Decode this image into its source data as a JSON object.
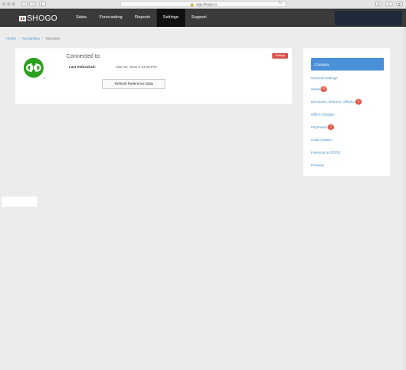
{
  "browser": {
    "url": "app.shogo.io",
    "lock_icon": "lock-icon",
    "back_glyph": "‹",
    "forward_glyph": "›",
    "reload_glyph": "↻",
    "share_glyph": "⇪",
    "tabs_glyph": "⧉"
  },
  "topnav": {
    "brand": "SHOGO",
    "items": [
      {
        "label": "Sales"
      },
      {
        "label": "Forecasting"
      },
      {
        "label": "Reports"
      },
      {
        "label": "Settings",
        "active": true
      },
      {
        "label": "Support"
      }
    ]
  },
  "breadcrumb": {
    "home": "Home",
    "accounting": "Accounting",
    "current": "Sessions",
    "separator": "/"
  },
  "connection": {
    "title": "Connected to:",
    "last_refreshed_label": "Last Refreshed:",
    "last_refreshed_value": "Mar 30, 2016 2:24:28 PM",
    "refresh_button": "Refresh Reference Data",
    "change_button": "Change",
    "logo_text": "qb",
    "logo_reg": "®"
  },
  "settings_menu": {
    "items": [
      {
        "label": "Company",
        "active": true
      },
      {
        "label": "General Settings"
      },
      {
        "label": "Sales",
        "badge": "10"
      },
      {
        "label": "Discounts, Returns, Offsets",
        "badge": "3"
      },
      {
        "label": "Other Charges"
      },
      {
        "label": "Payments",
        "badge": "2"
      },
      {
        "label": "Cash Drawer"
      },
      {
        "label": "Inventory & COGS"
      },
      {
        "label": "Preview"
      }
    ]
  },
  "colors": {
    "nav_bg": "#3a3a3a",
    "nav_active": "#111111",
    "accent": "#4a90d9",
    "link": "#4a90c8",
    "badge": "#e55a4e",
    "quickbooks_green": "#2ca01c",
    "change_red": "#d9534f"
  }
}
